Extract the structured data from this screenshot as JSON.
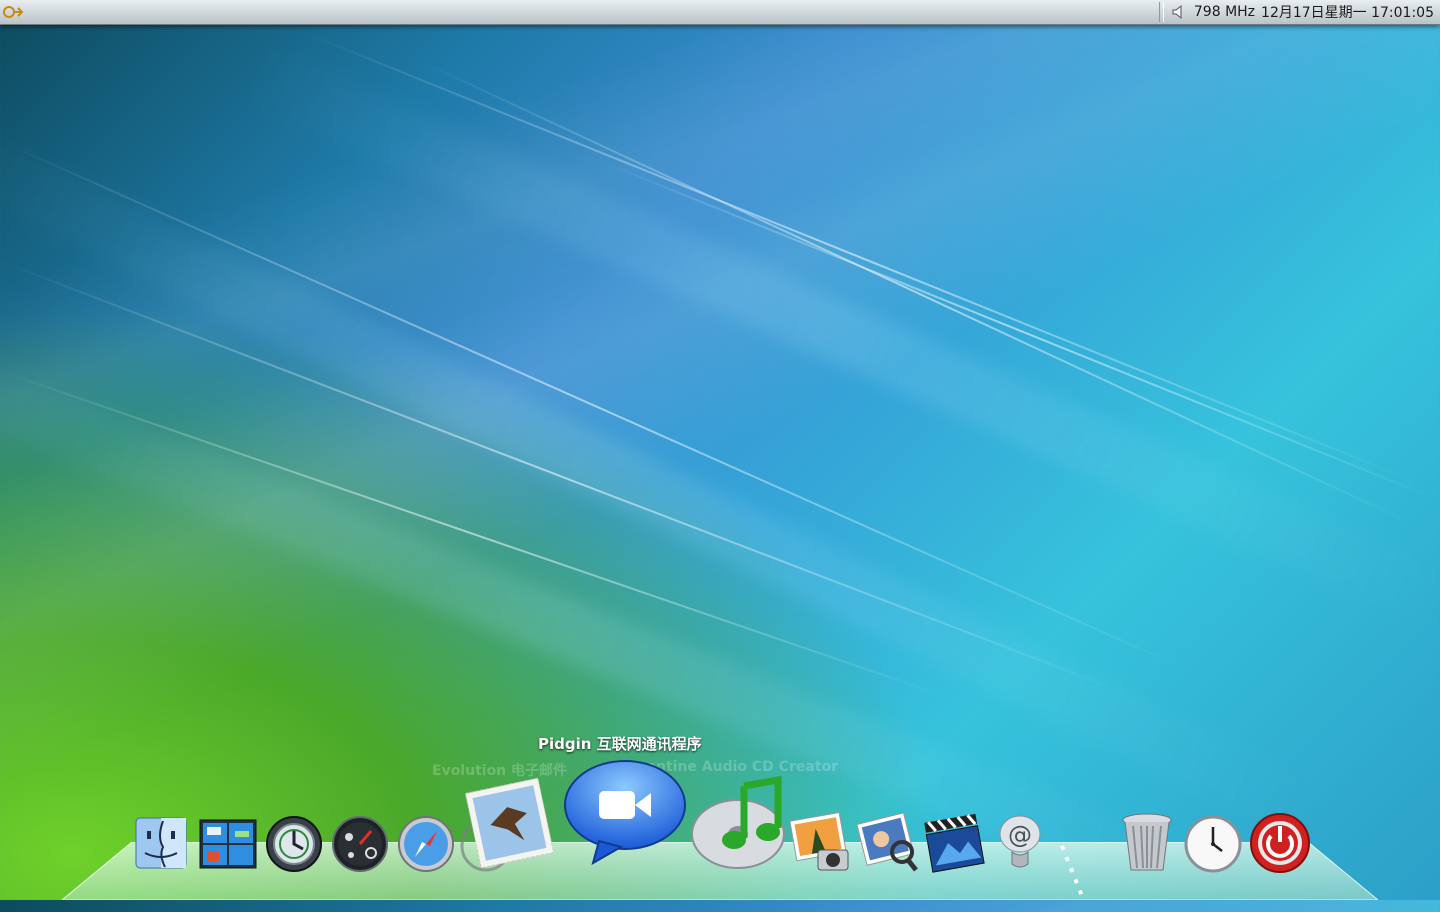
{
  "top_panel": {
    "menu_icon": "main-menu-icon",
    "cpu_freq": "798 MHz",
    "datetime": "12月17日星期一 17:01:05",
    "volume_icon": "speaker-icon"
  },
  "dock": {
    "hover_label": "Pidgin 互联网通讯程序",
    "faded_label_left": "Evolution 电子邮件",
    "faded_label_right": "Serpentine Audio CD Creator",
    "items": [
      {
        "icon": "finder-icon"
      },
      {
        "icon": "workspace-switcher-icon"
      },
      {
        "icon": "time-machine-icon"
      },
      {
        "icon": "dashboard-icon"
      },
      {
        "icon": "safari-icon"
      },
      {
        "icon": "mail-stamp-icon"
      },
      {
        "icon": "ichat-icon"
      },
      {
        "icon": "itunes-icon"
      },
      {
        "icon": "iphoto-icon"
      },
      {
        "icon": "image-viewer-icon"
      },
      {
        "icon": "imovie-icon"
      },
      {
        "icon": "email-at-icon"
      },
      {
        "icon": "trash-icon"
      },
      {
        "icon": "clock-icon"
      },
      {
        "icon": "shutdown-icon"
      }
    ]
  },
  "colors": {
    "panel_top": "#e9eef0",
    "panel_bottom": "#b9c3c7",
    "wallpaper_green": "#6fd12a",
    "wallpaper_cyan": "#36c3dc"
  }
}
